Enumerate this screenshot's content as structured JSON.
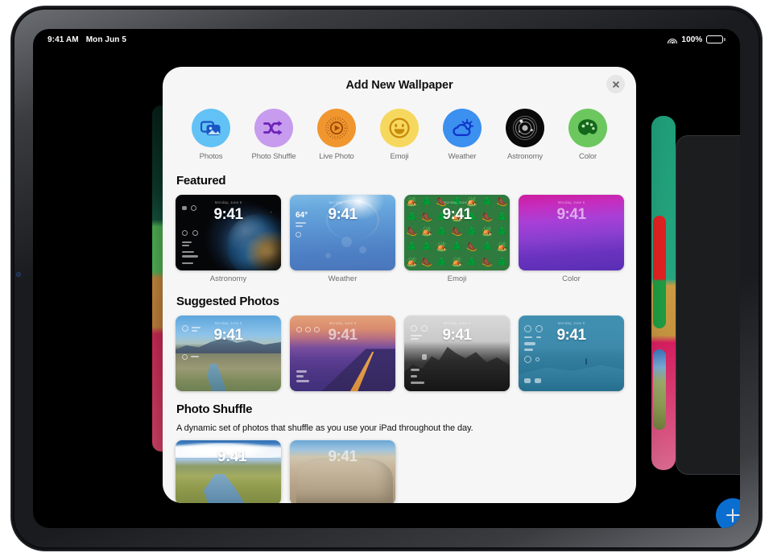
{
  "status_bar": {
    "time": "9:41 AM",
    "date": "Mon Jun 5",
    "battery_percent": "100%",
    "wifi_icon": "wifi-icon",
    "battery_icon": "battery-icon"
  },
  "sheet": {
    "title": "Add New Wallpaper",
    "close_label": "×"
  },
  "categories": [
    {
      "label": "Photos",
      "icon": "photos-icon",
      "bubble_color": "#62c2f5",
      "icon_color": "#1a55c4"
    },
    {
      "label": "Photo Shuffle",
      "icon": "shuffle-icon",
      "bubble_color": "#c79bee",
      "icon_color": "#6d22b8"
    },
    {
      "label": "Live Photo",
      "icon": "live-photo-icon",
      "bubble_color": "#f0962f",
      "icon_color": "#9e4b06"
    },
    {
      "label": "Emoji",
      "icon": "emoji-smiley-icon",
      "bubble_color": "#f6d85e",
      "icon_color": "#c98a0a"
    },
    {
      "label": "Weather",
      "icon": "weather-cloud-sun-icon",
      "bubble_color": "#3b90f0",
      "icon_color": "#1134c9"
    },
    {
      "label": "Astronomy",
      "icon": "astronomy-orbit-icon",
      "bubble_color": "#0a0a0a",
      "icon_color": "#b8b8b8"
    },
    {
      "label": "Color",
      "icon": "color-palette-icon",
      "bubble_color": "#6cc75e",
      "icon_color": "#14661c"
    }
  ],
  "featured": {
    "heading": "Featured",
    "items": [
      {
        "caption": "Astronomy",
        "time": "9:41",
        "date": "Monday, June 5",
        "art": "art-astronomy"
      },
      {
        "caption": "Weather",
        "time": "9:41",
        "date": "Monday, June 5",
        "art": "art-weather",
        "temp": "64°"
      },
      {
        "caption": "Emoji",
        "time": "9:41",
        "date": "Monday, June 5",
        "art": "art-emoji"
      },
      {
        "caption": "Color",
        "time": "9:41",
        "date": "Monday, June 5",
        "art": "art-color"
      }
    ]
  },
  "suggested_photos": {
    "heading": "Suggested Photos",
    "items": [
      {
        "time": "9:41",
        "date": "Monday, June 5",
        "art": "art-photo-1"
      },
      {
        "time": "9:41",
        "date": "Monday, June 5",
        "art": "art-photo-2"
      },
      {
        "time": "9:41",
        "date": "Monday, June 5",
        "art": "art-photo-3"
      },
      {
        "time": "9:41",
        "date": "Monday, June 5",
        "art": "art-photo-4"
      }
    ]
  },
  "photo_shuffle": {
    "heading": "Photo Shuffle",
    "subtitle": "A dynamic set of photos that shuffle as you use your iPad throughout the day.",
    "items": [
      {
        "time": "9:41",
        "art": "art-shuffle-1"
      },
      {
        "time": "9:41",
        "art": "art-shuffle-2"
      }
    ]
  },
  "background": {
    "add_button_icon": "plus-icon",
    "accent_color": "#0a6ed1"
  }
}
